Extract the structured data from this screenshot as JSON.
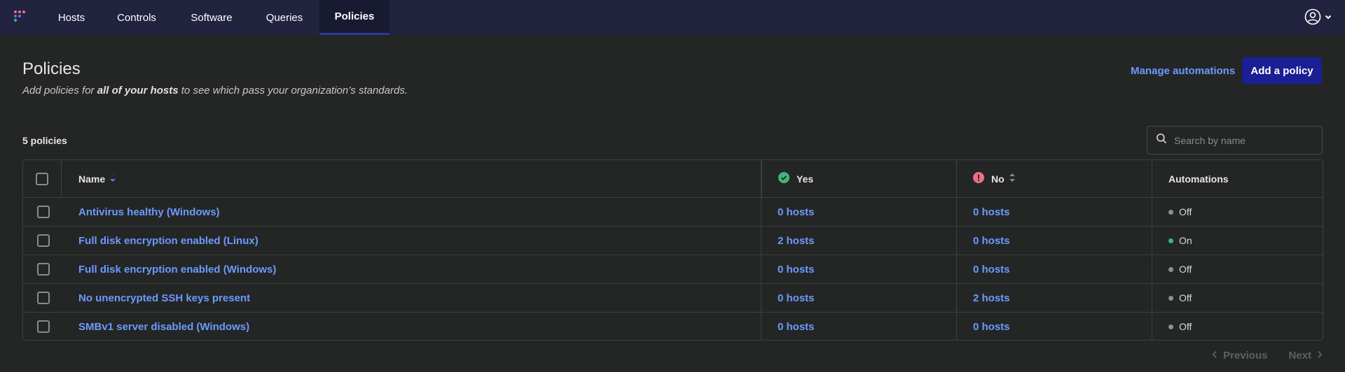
{
  "nav": {
    "items": [
      {
        "label": "Hosts"
      },
      {
        "label": "Controls"
      },
      {
        "label": "Software"
      },
      {
        "label": "Queries"
      },
      {
        "label": "Policies",
        "active": true
      }
    ]
  },
  "header": {
    "title": "Policies",
    "subtitle_pre": "Add policies for ",
    "subtitle_bold": "all of your hosts",
    "subtitle_post": " to see which pass your organization’s standards.",
    "manage_label": "Manage automations",
    "add_label": "Add a policy"
  },
  "toolbar": {
    "count": "5 policies",
    "search_placeholder": "Search by name"
  },
  "table": {
    "columns": {
      "name": "Name",
      "yes": "Yes",
      "no": "No",
      "automations": "Automations"
    },
    "rows": [
      {
        "name": "Antivirus healthy (Windows)",
        "yes": "0 hosts",
        "no": "0 hosts",
        "automation": "Off"
      },
      {
        "name": "Full disk encryption enabled (Linux)",
        "yes": "2 hosts",
        "no": "0 hosts",
        "automation": "On"
      },
      {
        "name": "Full disk encryption enabled (Windows)",
        "yes": "0 hosts",
        "no": "0 hosts",
        "automation": "Off"
      },
      {
        "name": "No unencrypted SSH keys present",
        "yes": "0 hosts",
        "no": "2 hosts",
        "automation": "Off"
      },
      {
        "name": "SMBv1 server disabled (Windows)",
        "yes": "0 hosts",
        "no": "0 hosts",
        "automation": "Off"
      }
    ]
  },
  "pagination": {
    "previous": "Previous",
    "next": "Next"
  },
  "colors": {
    "nav_bg": "#21233f",
    "link": "#6b9aff",
    "primary_button": "#1a1f94",
    "yes_icon": "#3db67b",
    "no_icon": "#ed6e85",
    "status_on": "#3db67b",
    "status_off": "#8b8fa2"
  }
}
